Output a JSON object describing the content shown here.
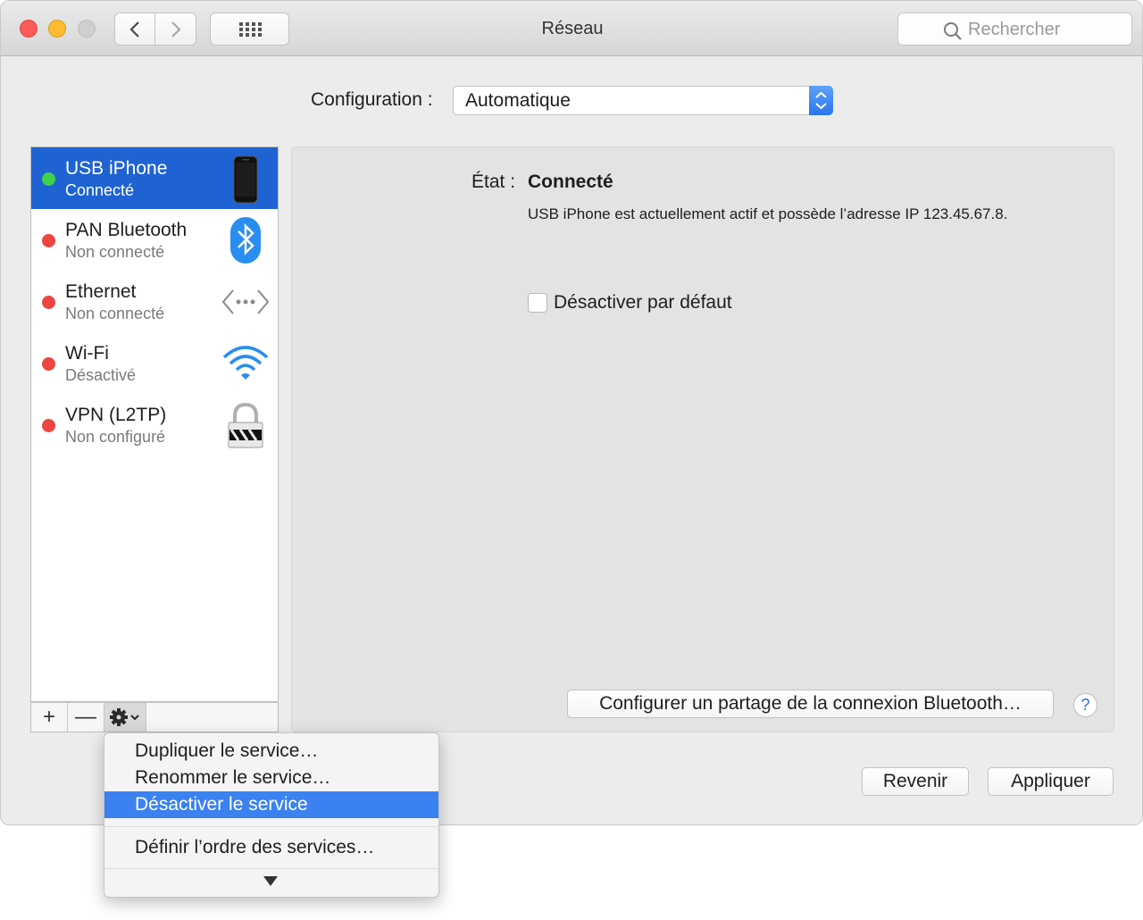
{
  "window": {
    "title": "Réseau"
  },
  "toolbar": {
    "back_icon": "chevron-left-icon",
    "forward_icon": "chevron-right-icon",
    "grid_icon": "grid-icon",
    "search_placeholder": "Rechercher"
  },
  "config": {
    "label": "Configuration :",
    "value": "Automatique"
  },
  "services": [
    {
      "name": "USB iPhone",
      "status": "Connecté",
      "state": "connected",
      "icon": "iphone-icon",
      "selected": true
    },
    {
      "name": "PAN Bluetooth",
      "status": "Non connecté",
      "state": "disconnected",
      "icon": "bluetooth-icon"
    },
    {
      "name": "Ethernet",
      "status": "Non connecté",
      "state": "disconnected",
      "icon": "ethernet-icon"
    },
    {
      "name": "Wi-Fi",
      "status": "Désactivé",
      "state": "disconnected",
      "icon": "wifi-icon"
    },
    {
      "name": "VPN (L2TP)",
      "status": "Non configuré",
      "state": "disconnected",
      "icon": "vpn-lock-icon"
    }
  ],
  "list_toolbar": {
    "add": "+",
    "remove": "—",
    "gear_icon": "gear-icon"
  },
  "detail": {
    "state_label": "État :",
    "state_value": "Connecté",
    "description": "USB iPhone  est actuellement actif et possède l’adresse IP 123.45.67.8.",
    "checkbox_label": "Désactiver par défaut",
    "bt_share_button": "Configurer un partage de la connexion Bluetooth…",
    "help": "?"
  },
  "footer": {
    "revert": "Revenir",
    "apply": "Appliquer"
  },
  "menu": {
    "duplicate": "Dupliquer le service…",
    "rename": "Renommer le service…",
    "disable": "Désactiver le service",
    "order": "Définir l’ordre des services…"
  },
  "colors": {
    "selection": "#1f63d3",
    "highlight": "#3b82f0",
    "green": "#3fd34a",
    "red": "#ed4541"
  }
}
